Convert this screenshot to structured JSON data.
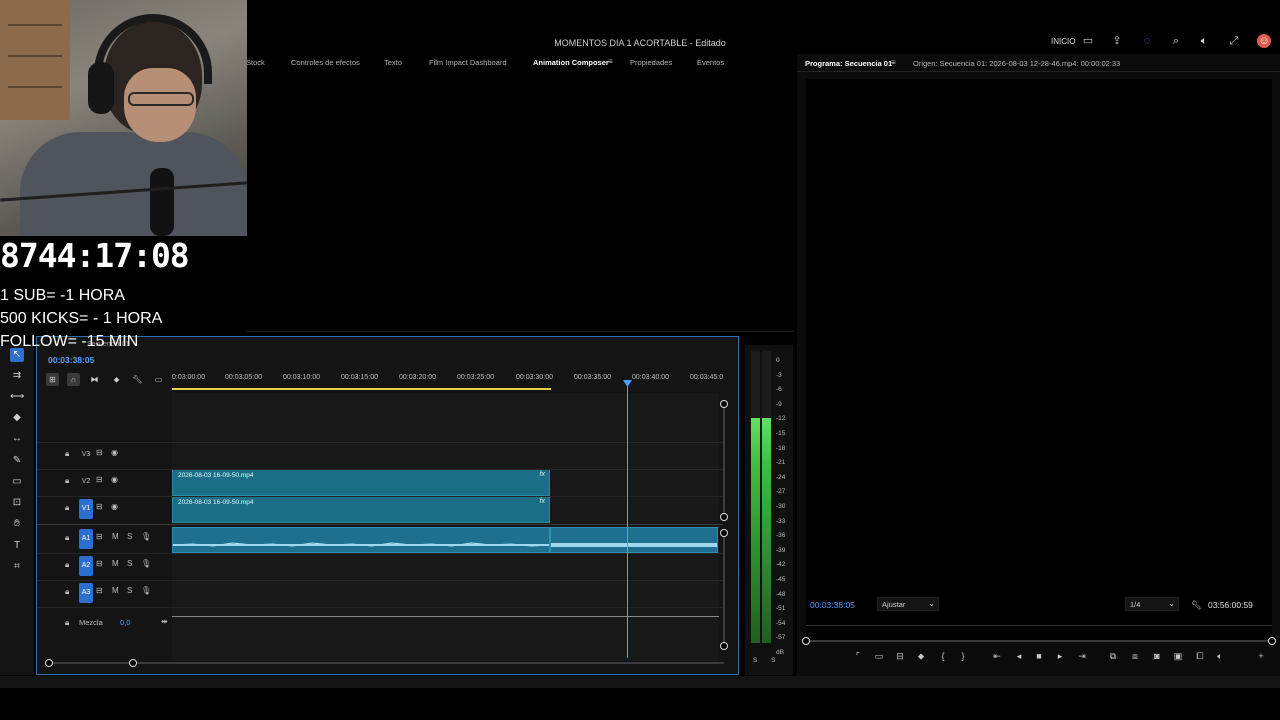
{
  "window": {
    "title": "MOMENTOS DIA 1 ACORTABLE - Editado",
    "inicio": "INICIO"
  },
  "effects_panel": {
    "tabs": [
      "Stock",
      "Controles de efectos",
      "Texto",
      "Film Impact Dashboard",
      "Animation Composer",
      "Propiedades",
      "Eventos"
    ],
    "active_tab": "Animation Composer"
  },
  "program_panel": {
    "tab_program": "Programa: Secuencia 01",
    "tab_source": "Origen: Secuencia 01: 2026-08-03 12-28-46.mp4: 00:00:02:33",
    "current_time": "00:03:38:05",
    "fit": "Ajustar",
    "resolution": "1/4",
    "duration": "03:56:00:59"
  },
  "overlay": {
    "timer": "8744:17:08",
    "rule1": "1 SUB= -1 HORA",
    "rule2": "500 KICKS= - 1 HORA",
    "rule3": "FOLLOW= -15 MIN"
  },
  "timeline": {
    "sequence": "Secuencia 01",
    "current_time": "00:03:38:05",
    "ruler": [
      "0:03:00:00",
      "00:03:05:00",
      "00:03:10:00",
      "00:03:15:00",
      "00:03:20:00",
      "00:03:25:00",
      "00:03:30:00",
      "00:03:35:00",
      "00:03:40:00",
      "00:03:45:0"
    ],
    "video_tracks": [
      "V3",
      "V2",
      "V1"
    ],
    "audio_tracks": [
      "A1",
      "A2",
      "A3"
    ],
    "clips": [
      {
        "name": "2026-08-03 16-09-50.mp4",
        "fx": "fx"
      },
      {
        "name": "2026-08-03 16-09-50.mp4",
        "fx": "fx"
      }
    ],
    "mix_label": "Mezcla",
    "mix_value": "0,0",
    "mute": "M",
    "solo": "S"
  },
  "meter": {
    "db_labels": [
      "0",
      "-3",
      "-6",
      "-9",
      "-12",
      "-15",
      "-18",
      "-21",
      "-24",
      "-27",
      "-30",
      "-33",
      "-36",
      "-39",
      "-42",
      "-45",
      "-48",
      "-51",
      "-54",
      "-57",
      "dB"
    ],
    "ss": "S S",
    "level_left": 0.77,
    "level_right": 0.77
  }
}
